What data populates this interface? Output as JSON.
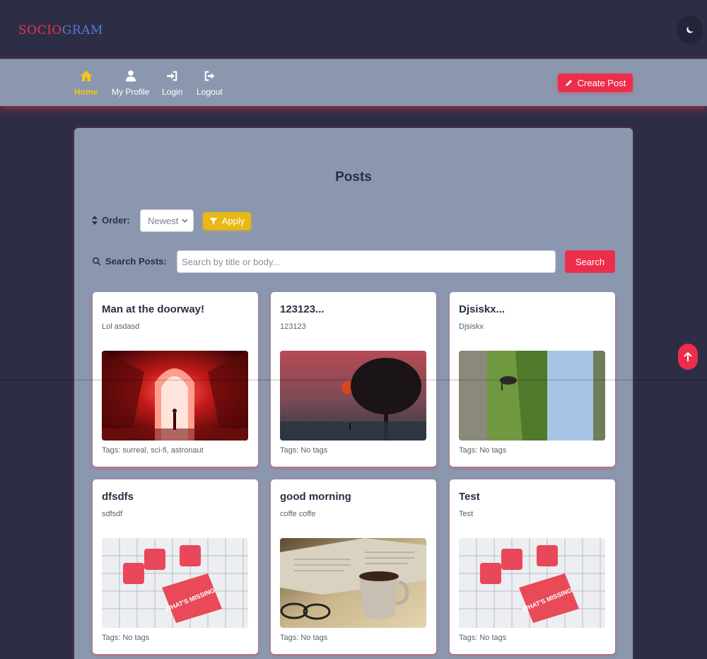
{
  "app": {
    "logo_part1": "SOCIO",
    "logo_part2": "GRAM"
  },
  "nav": {
    "items": [
      {
        "label": "Home",
        "icon": "home-icon",
        "active": true
      },
      {
        "label": "My Profile",
        "icon": "user-icon",
        "active": false
      },
      {
        "label": "Login",
        "icon": "login-icon",
        "active": false
      },
      {
        "label": "Logout",
        "icon": "logout-icon",
        "active": false
      }
    ],
    "create_post_label": "Create Post"
  },
  "main": {
    "title": "Posts",
    "order_label": "Order:",
    "order_value": "Newest",
    "apply_label": "Apply",
    "search_label": "Search Posts:",
    "search_placeholder": "Search by title or body...",
    "search_button": "Search"
  },
  "posts": [
    {
      "title": "Man at the doorway!",
      "body": "Lol asdasd",
      "tags": "Tags: surreal, sci-fi, astronaut",
      "image": "red-doorway"
    },
    {
      "title": "123123...",
      "body": "123123",
      "tags": "Tags: No tags",
      "image": "foggy-tree"
    },
    {
      "title": "Djsiskx...",
      "body": "Djsiskx",
      "tags": "Tags: No tags",
      "image": "grass-field"
    },
    {
      "title": "dfsdfs",
      "body": "sdfsdf",
      "tags": "Tags: No tags",
      "image": "puzzle-missing"
    },
    {
      "title": "good morning",
      "body": "coffe coffe",
      "tags": "Tags: No tags",
      "image": "coffee-newspaper"
    },
    {
      "title": "Test",
      "body": "Test",
      "tags": "Tags: No tags",
      "image": "puzzle-missing"
    }
  ],
  "puzzle_text": "WHAT'S MISSING",
  "colors": {
    "accent": "#ec2e4c",
    "warning": "#e9b816",
    "active_nav": "#f5c518",
    "background": "#2d2e45",
    "panel": "#8b97ae"
  }
}
